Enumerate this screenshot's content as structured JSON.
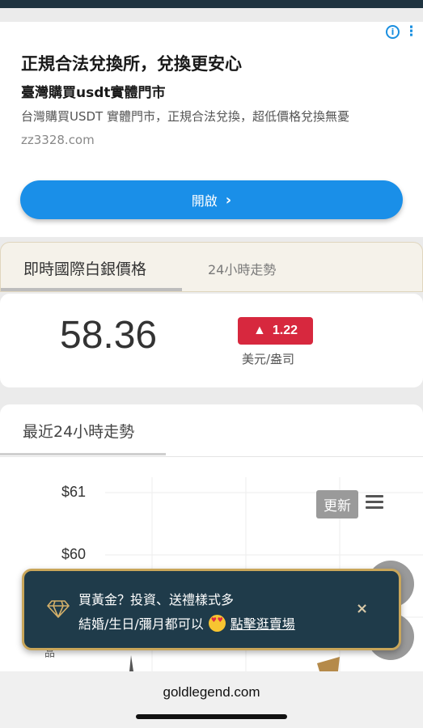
{
  "ad": {
    "title": "正規合法兌換所，兌換更安心",
    "subtitle": "臺灣購買usdt實體門市",
    "description": "台灣購買USDT 實體門市，正規合法兌換，超低價格兌換無憂",
    "url": "zz3328.com",
    "button_label": "開啟",
    "info_glyph": "i",
    "more_glyph": "⋮",
    "accent": "#1a8fe8"
  },
  "tabs": {
    "active": "即時國際白銀價格",
    "second": "24小時走勢"
  },
  "price": {
    "value": "58.36",
    "change_arrow": "▲",
    "change": "1.22",
    "unit": "美元/盎司",
    "up_color": "#d7283e"
  },
  "trend": {
    "title": "最近24小時走勢",
    "y_ticks": [
      "$61",
      "$60"
    ],
    "refresh_label": "更新",
    "side_label": "品"
  },
  "promo": {
    "line1": "買黃金？投資、送禮樣式多",
    "line2_prefix": "結婚/生日/彌月都可以",
    "link": "點擊逛賣場",
    "close": "×",
    "border_color": "#c9a65a"
  },
  "browser": {
    "url": "goldlegend.com"
  }
}
